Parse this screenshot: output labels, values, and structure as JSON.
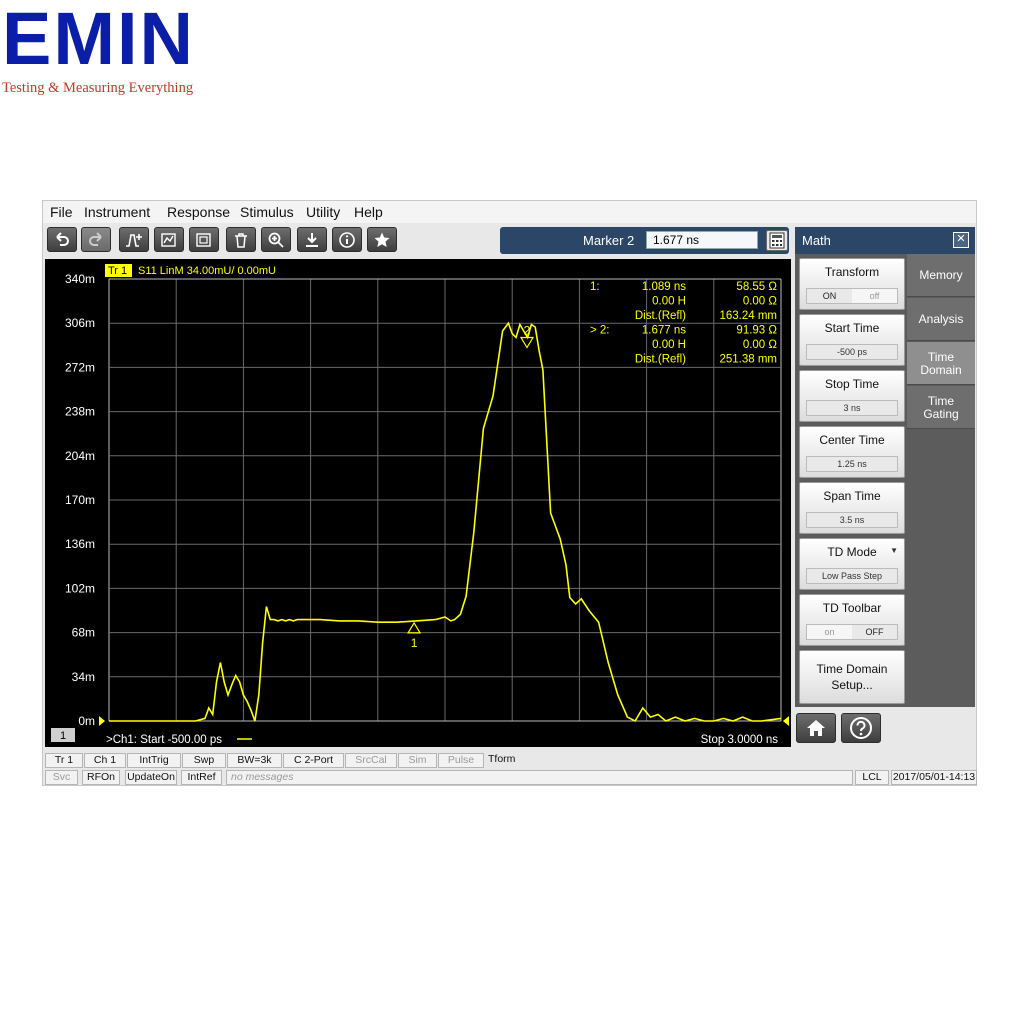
{
  "branding": {
    "logo_text": "EMIN",
    "tagline": "Testing & Measuring Everything"
  },
  "menu": [
    "File",
    "Instrument",
    "Response",
    "Stimulus",
    "Utility",
    "Help"
  ],
  "toolbar": {
    "buttons": [
      "undo-icon",
      "redo-icon",
      "marker-add-icon",
      "trace-add-icon",
      "window-add-icon",
      "delete-icon",
      "zoom-icon",
      "save-icon",
      "info-icon",
      "favorite-icon"
    ]
  },
  "marker_bar": {
    "label": "Marker 2",
    "value": "1.677 ns"
  },
  "plot": {
    "trace_tag": "Tr 1",
    "trace_header": "S11 LinM 34.00mU/  0.00mU",
    "channel_badge": "1",
    "start_label": ">Ch1:  Start  -500.00 ps",
    "stop_label": "Stop  3.0000 ns",
    "trace_color": "#ffff00",
    "marker_readout": [
      {
        "id": "1:",
        "a": "1.089  ns",
        "b": "58.55 Ω"
      },
      {
        "id": "",
        "a": "0.00 H",
        "b": "0.00 Ω"
      },
      {
        "id": "",
        "a": "Dist.(Refl)",
        "b": "163.24 mm"
      },
      {
        "id": "> 2:",
        "a": "1.677  ns",
        "b": "91.93 Ω"
      },
      {
        "id": "",
        "a": "0.00 H",
        "b": "0.00 Ω"
      },
      {
        "id": "",
        "a": "Dist.(Refl)",
        "b": "251.38 mm"
      }
    ],
    "marker1_label": "1",
    "marker2_label": "2"
  },
  "chart_data": {
    "type": "line",
    "title": "",
    "xlabel": "",
    "ylabel": "",
    "xlim": [
      -0.5,
      3.0
    ],
    "ylim": [
      0,
      340
    ],
    "yticks": [
      "340m",
      "306m",
      "272m",
      "238m",
      "204m",
      "170m",
      "136m",
      "102m",
      "68m",
      "34m",
      "0m"
    ],
    "grid": true,
    "series": [
      {
        "x": [
          -0.5,
          -0.05,
          0.0,
          0.02,
          0.04,
          0.06,
          0.08,
          0.1,
          0.12,
          0.14,
          0.16,
          0.18,
          0.2,
          0.22,
          0.24,
          0.26,
          0.28,
          0.3,
          0.32,
          0.34,
          0.36,
          0.38,
          0.4,
          0.42,
          0.44,
          0.46,
          0.48,
          0.5,
          0.6,
          0.7,
          0.8,
          0.9,
          1.0,
          1.1,
          1.2,
          1.25,
          1.28,
          1.3,
          1.33,
          1.36,
          1.4,
          1.45,
          1.5,
          1.55,
          1.58,
          1.6,
          1.62,
          1.64,
          1.66,
          1.68,
          1.7,
          1.72,
          1.74,
          1.76,
          1.8,
          1.85,
          1.88,
          1.9,
          1.93,
          1.96,
          2.0,
          2.05,
          2.1,
          2.15,
          2.2,
          2.24,
          2.28,
          2.32,
          2.36,
          2.4,
          2.45,
          2.5,
          2.55,
          2.6,
          2.65,
          2.7,
          2.75,
          2.8,
          2.85,
          2.9,
          2.95,
          3.0
        ],
        "y": [
          0,
          0,
          2,
          10,
          5,
          30,
          45,
          30,
          20,
          28,
          35,
          30,
          20,
          15,
          8,
          0,
          20,
          60,
          88,
          78,
          78,
          77,
          78,
          77,
          78,
          77,
          78,
          78,
          78,
          77,
          77,
          76,
          76,
          77,
          78,
          80,
          77,
          78,
          82,
          96,
          145,
          225,
          250,
          300,
          306,
          298,
          295,
          305,
          300,
          295,
          305,
          303,
          285,
          270,
          160,
          140,
          120,
          95,
          90,
          94,
          85,
          76,
          45,
          20,
          3,
          0,
          10,
          3,
          5,
          0,
          3,
          0,
          2,
          0,
          0,
          2,
          0,
          3,
          0,
          0,
          1,
          2
        ]
      }
    ],
    "markers": [
      {
        "name": "1",
        "x": 1.089,
        "y": 58.55
      },
      {
        "name": "2",
        "x": 1.677,
        "y": 306
      }
    ]
  },
  "math_panel": {
    "title": "Math",
    "softkeys": [
      {
        "title": "Transform",
        "on": "ON",
        "off": "off"
      },
      {
        "title": "Start Time",
        "value": "-500 ps"
      },
      {
        "title": "Stop Time",
        "value": "3 ns"
      },
      {
        "title": "Center Time",
        "value": "1.25 ns"
      },
      {
        "title": "Span Time",
        "value": "3.5 ns"
      },
      {
        "title": "TD Mode",
        "value": "Low Pass Step"
      },
      {
        "title": "TD Toolbar",
        "on": "on",
        "off": "OFF"
      },
      {
        "title": "Time Domain Setup..."
      }
    ],
    "tabs": [
      "Memory",
      "Analysis",
      "Time Domain",
      "Time Gating"
    ]
  },
  "status_row1": [
    "Tr 1",
    "Ch 1",
    "IntTrig",
    "Swp",
    "BW=3k",
    "C  2-Port",
    "SrcCal",
    "Sim",
    "Pulse",
    "Tform"
  ],
  "status_row2": [
    "Svc",
    "RFOn",
    "UpdateOn",
    "IntRef",
    "no messages",
    "LCL",
    "2017/05/01-14:13"
  ]
}
